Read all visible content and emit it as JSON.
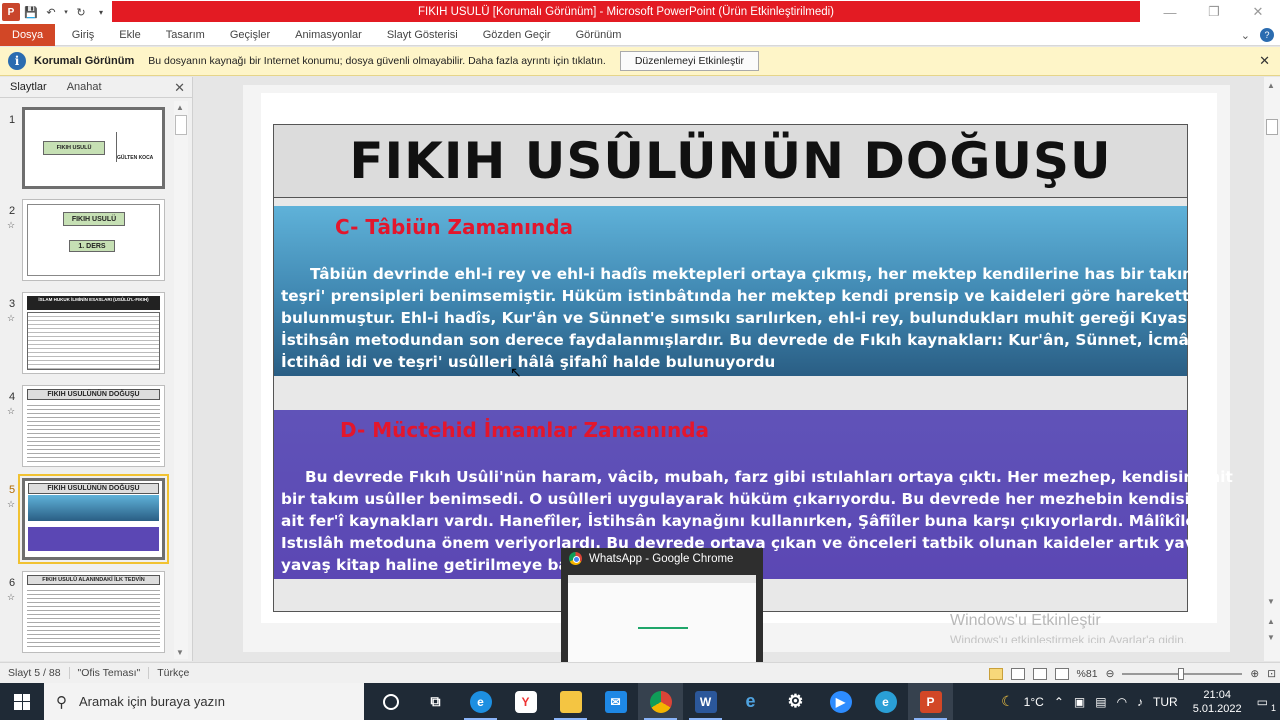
{
  "window": {
    "title": "FIKIH USULÜ [Korumalı Görünüm] - Microsoft PowerPoint (Ürün Etkinleştirilmedi)"
  },
  "ribbon": {
    "file": "Dosya",
    "tabs": [
      "Giriş",
      "Ekle",
      "Tasarım",
      "Geçişler",
      "Animasyonlar",
      "Slayt Gösterisi",
      "Gözden Geçir",
      "Görünüm"
    ]
  },
  "protected_view": {
    "title": "Korumalı Görünüm",
    "message": "Bu dosyanın kaynağı bir Internet konumu; dosya güvenli olmayabilir. Daha fazla ayrıntı için tıklatın.",
    "button": "Düzenlemeyi Etkinleştir"
  },
  "left_pane": {
    "tabs": [
      "Slaytlar",
      "Anahat"
    ],
    "slides": [
      {
        "num": "1",
        "title": "FIKIH USULÜ",
        "author": "GÜLTEN KOCA"
      },
      {
        "num": "2",
        "title": "FIKIH USULÜ",
        "sub": "1. DERS"
      },
      {
        "num": "3",
        "title": "İSLAM HUKUK İLMİNİN ESASLARI (USÛLÜ'L-FIKIH)"
      },
      {
        "num": "4",
        "title": "FIKIH USULÜNÜN DOĞUŞU"
      },
      {
        "num": "5",
        "title": "FIKIH USULÜNÜN DOĞUŞU"
      },
      {
        "num": "6",
        "title": "FIKIH USULÜ ALANINDAKİ İLK TEDVİN"
      }
    ]
  },
  "slide": {
    "title": "FIKIH USÛLÜNÜN DOĞUŞU",
    "section_c": {
      "heading": "C- Tâbiün Zamanında",
      "lines": [
        "Tâbiün devrinde ehl-i rey ve ehl-i hadîs mektepleri ortaya çıkmış, her mektep kendilerine has bir takım",
        "teşri' prensipleri benimsemiştir. Hüküm istinbâtında her mektep kendi prensip ve kaideleri göre harekette",
        "bulunmuştur. Ehl-i hadîs, Kur'ân ve Sünnet'e sımsıkı sarılırken, ehl-i rey, bulundukları muhit gereği Kıyas ve",
        "İstihsân metodundan son derece faydalanmışlardır. Bu devrede de Fıkıh kaynakları: Kur'ân, Sünnet, İcmâ ve",
        "İctihâd idi ve teşri' usûlleri hâlâ şifahî halde bulunuyordu"
      ]
    },
    "section_d": {
      "heading": "D- Müctehid İmamlar Zamanında",
      "lines": [
        "Bu devrede Fıkıh Usûli'nün haram, vâcib, mubah, farz gibi ıstılahları ortaya çıktı. Her mezhep, kendisine ait",
        "bir takım usûller benimsedi. O usûlleri uygulayarak hüküm çıkarıyordu. Bu devrede her mezhebin kendisine",
        "ait fer'î kaynakları vardı. Hanefîler, İstihsân kaynağını kullanırken, Şâfiîler buna karşı çıkıyorlardı. Mâlîkîler,",
        "Istıslâh metoduna önem veriyorlardı. Bu devrede ortaya çıkan ve önceleri tatbik olunan kaideler artık yavaş",
        "yavaş kitap haline getirilmeye başladı."
      ]
    }
  },
  "watermark": {
    "title": "Windows'u Etkinleştir",
    "sub": "Windows'u etkinleştirmek için Ayarlar'a gidin."
  },
  "taskbar_preview": {
    "title": "WhatsApp - Google Chrome"
  },
  "status": {
    "slide_info": "Slayt 5 / 88",
    "theme": "\"Ofis Teması\"",
    "language": "Türkçe",
    "zoom": "%81"
  },
  "taskbar": {
    "search_placeholder": "Aramak için buraya yazın",
    "weather": "1°C",
    "lang": "TUR",
    "time": "21:04",
    "date": "5.01.2022",
    "notif_count": "1"
  },
  "colors": {
    "title_bar": "#e31b23",
    "file_tab": "#d24726",
    "section_c": "#3f86b0",
    "section_d": "#5b47b4",
    "heading_red": "#e3162c"
  }
}
